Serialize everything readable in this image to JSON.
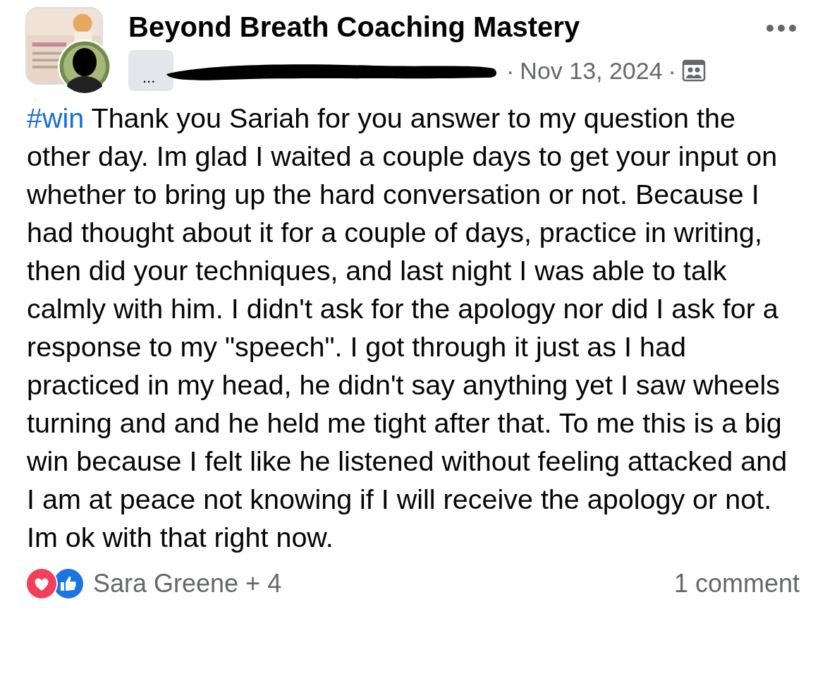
{
  "post": {
    "group_name": "Beyond Breath Coaching Mastery",
    "author_badge": "...",
    "date": "Nov 13, 2024",
    "separator": "·",
    "hashtag": "#win",
    "text": " Thank you Sariah for you answer to my question the other day. Im glad I waited a couple days to get your input on whether to bring up the hard conversation or not. Because I had thought about it for a couple of days, practice in writing, then did your techniques, and last night I was able to talk calmly with him. I didn't ask for the apology nor did I ask for a response to my \"speech\". I got through it just as I had practiced in my head, he didn't say anything yet I saw wheels turning and and he held me tight after that. To me this is a big win because I felt like he listened without feeling attacked and I am at peace not knowing if I will receive the apology or not. Im ok with that right now."
  },
  "footer": {
    "reactions": [
      {
        "kind": "love"
      },
      {
        "kind": "like"
      }
    ],
    "reactors": "Sara Greene + 4",
    "comments": "1 comment"
  }
}
